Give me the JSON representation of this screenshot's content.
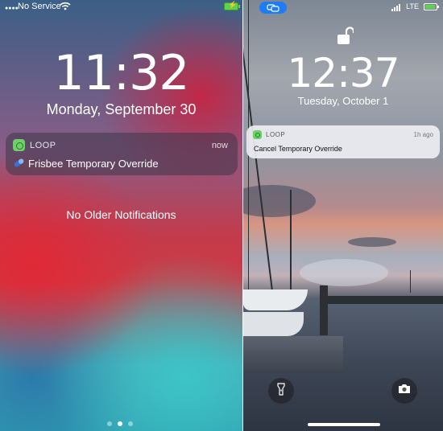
{
  "left_screen": {
    "status": {
      "carrier": "No Service"
    },
    "clock": "11:32",
    "date": "Monday, September 30",
    "notification": {
      "app": "LOOP",
      "time": "now",
      "message": "Frisbee Temporary Override"
    },
    "no_older_label": "No Older Notifications",
    "page_dots": {
      "count": 3,
      "active_index": 1
    }
  },
  "right_screen": {
    "status": {
      "network": "LTE"
    },
    "clock": "12:37",
    "date": "Tuesday, October 1",
    "notification": {
      "app": "LOOP",
      "time": "1h ago",
      "message": "Cancel Temporary Override"
    }
  },
  "colors": {
    "accent_blue": "#1e7cf5",
    "app_icon_green": "#6fcf6a",
    "battery_green": "#5fd14f"
  },
  "icons": {
    "wifi": "wifi-icon",
    "lock_open": "unlocked-padlock-icon",
    "flashlight": "flashlight-icon",
    "camera": "camera-icon",
    "screen_mirror": "screen-mirroring-icon",
    "pill": "pill-icon"
  }
}
